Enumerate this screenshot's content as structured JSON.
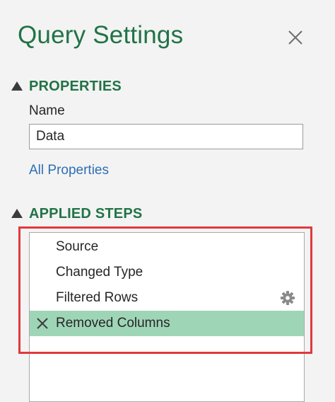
{
  "panel": {
    "title": "Query Settings"
  },
  "properties": {
    "header": "PROPERTIES",
    "name_label": "Name",
    "name_value": "Data",
    "all_properties_link": "All Properties"
  },
  "applied_steps": {
    "header": "APPLIED STEPS",
    "steps": [
      {
        "label": "Source"
      },
      {
        "label": "Changed Type"
      },
      {
        "label": "Filtered Rows",
        "has_settings": true
      },
      {
        "label": "Removed Columns",
        "selected": true
      }
    ]
  },
  "colors": {
    "accent_green": "#217346",
    "link_blue": "#2e6fb3",
    "selected_row": "#9fd5b7",
    "highlight_red": "#e0393e"
  },
  "icons": {
    "close": "close-icon",
    "collapse": "triangle-collapse-icon",
    "delete_step": "x-delete-icon",
    "settings": "gear-icon"
  }
}
